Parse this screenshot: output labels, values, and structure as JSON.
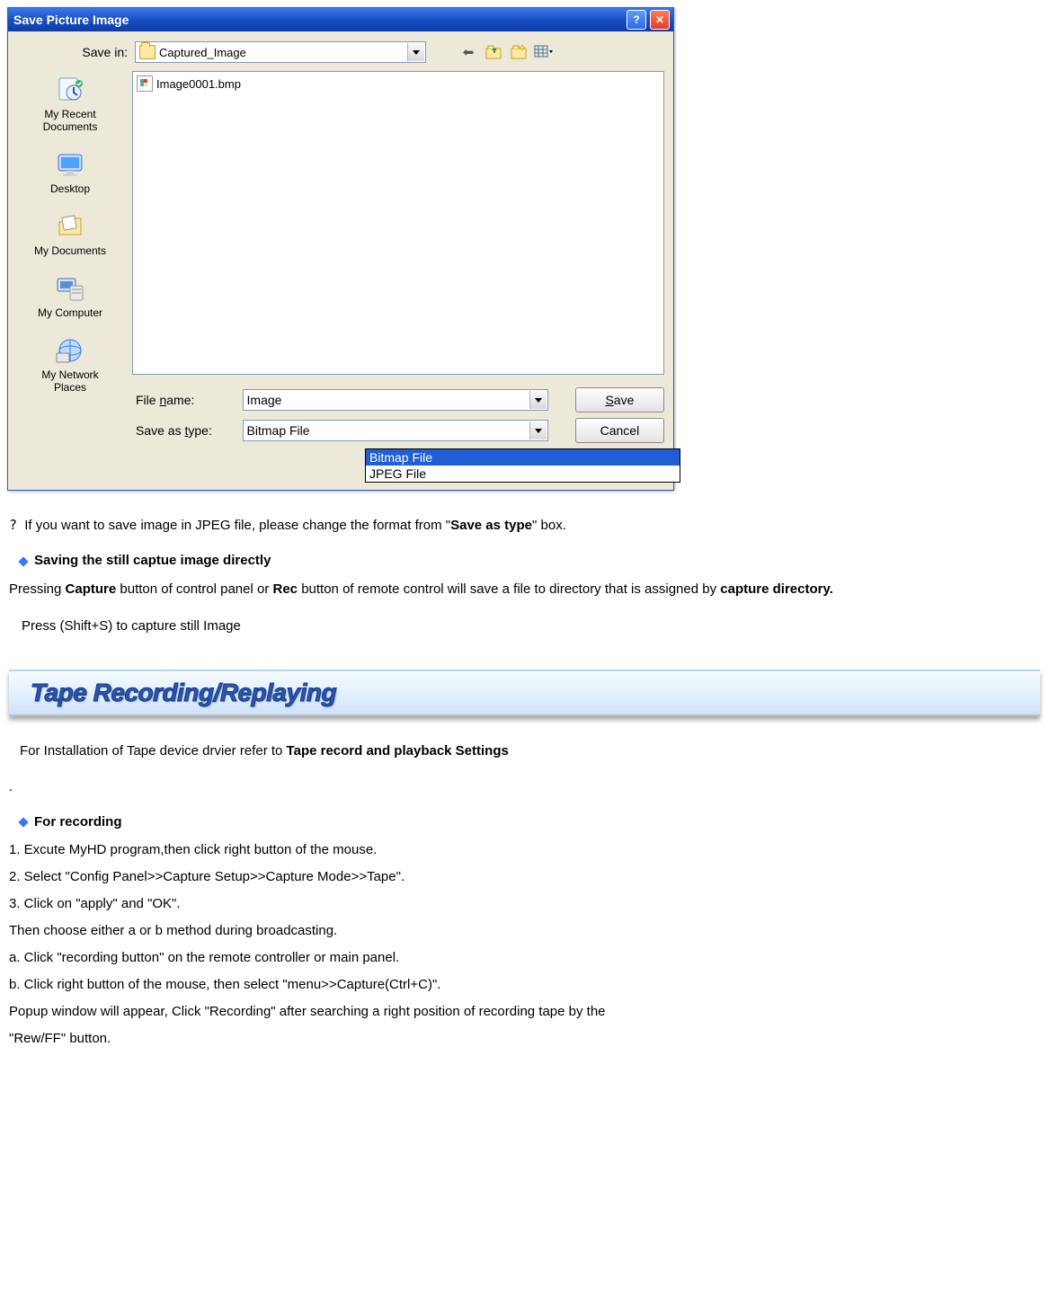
{
  "dialog": {
    "title": "Save Picture Image",
    "savein_label": "Save in:",
    "savein_value": "Captured_Image",
    "file_list": {
      "item0": "Image0001.bmp"
    },
    "places": {
      "recent": "My Recent\nDocuments",
      "desktop": "Desktop",
      "mydocs": "My Documents",
      "mycomp": "My Computer",
      "network": "My Network\nPlaces"
    },
    "filename_label": "File name:",
    "filename_value": "Image",
    "saveastype_label": "Save as type:",
    "saveastype_value": "Bitmap File",
    "type_options": {
      "opt0": "Bitmap File",
      "opt1": "JPEG File"
    },
    "save_btn_letter": "S",
    "save_btn_rest": "ave",
    "cancel_btn": "Cancel"
  },
  "doc": {
    "tip_prefix": "?",
    "tip_text_a": "If you want to save image in JPEG file, please change the format from \"",
    "tip_text_bold": "Save as type",
    "tip_text_b": "\" box.",
    "heading1": "Saving the still captue image directly",
    "para1_a": "Pressing ",
    "para1_b1": "Capture",
    "para1_c": " button of control panel or ",
    "para1_b2": "Rec",
    "para1_d": " button of remote control will save a file to directory that is assigned by ",
    "para1_b3": "capture directory.",
    "note1": "Press (Shift+S) to capture still Image",
    "banner": "Tape Recording/Replaying",
    "ref_a": "For Installation of ",
    "ref_b": "Tape device drvier",
    "ref_c": " refer to ",
    "ref_bold": "Tape record and playback Settings",
    "dot": ".",
    "heading2": "For recording",
    "steps": {
      "s1": "1. Excute MyHD program,then click right button of the mouse.",
      "s2": "2. Select \"Config Panel>>Capture Setup>>Capture Mode>>Tape\".",
      "s3": "3. Click on \"apply\" and \"OK\".",
      "s4": "Then choose either a or b method during broadcasting.",
      "s5": "a. Click \"recording button\" on the remote controller or main panel.",
      "s6": "b. Click right button of the mouse, then select \"menu>>Capture(Ctrl+C)\".",
      "s7": "Popup window will appear, Click \"Recording\" after searching a right position of recording tape by the",
      "s8": "\"Rew/FF\" button."
    }
  }
}
